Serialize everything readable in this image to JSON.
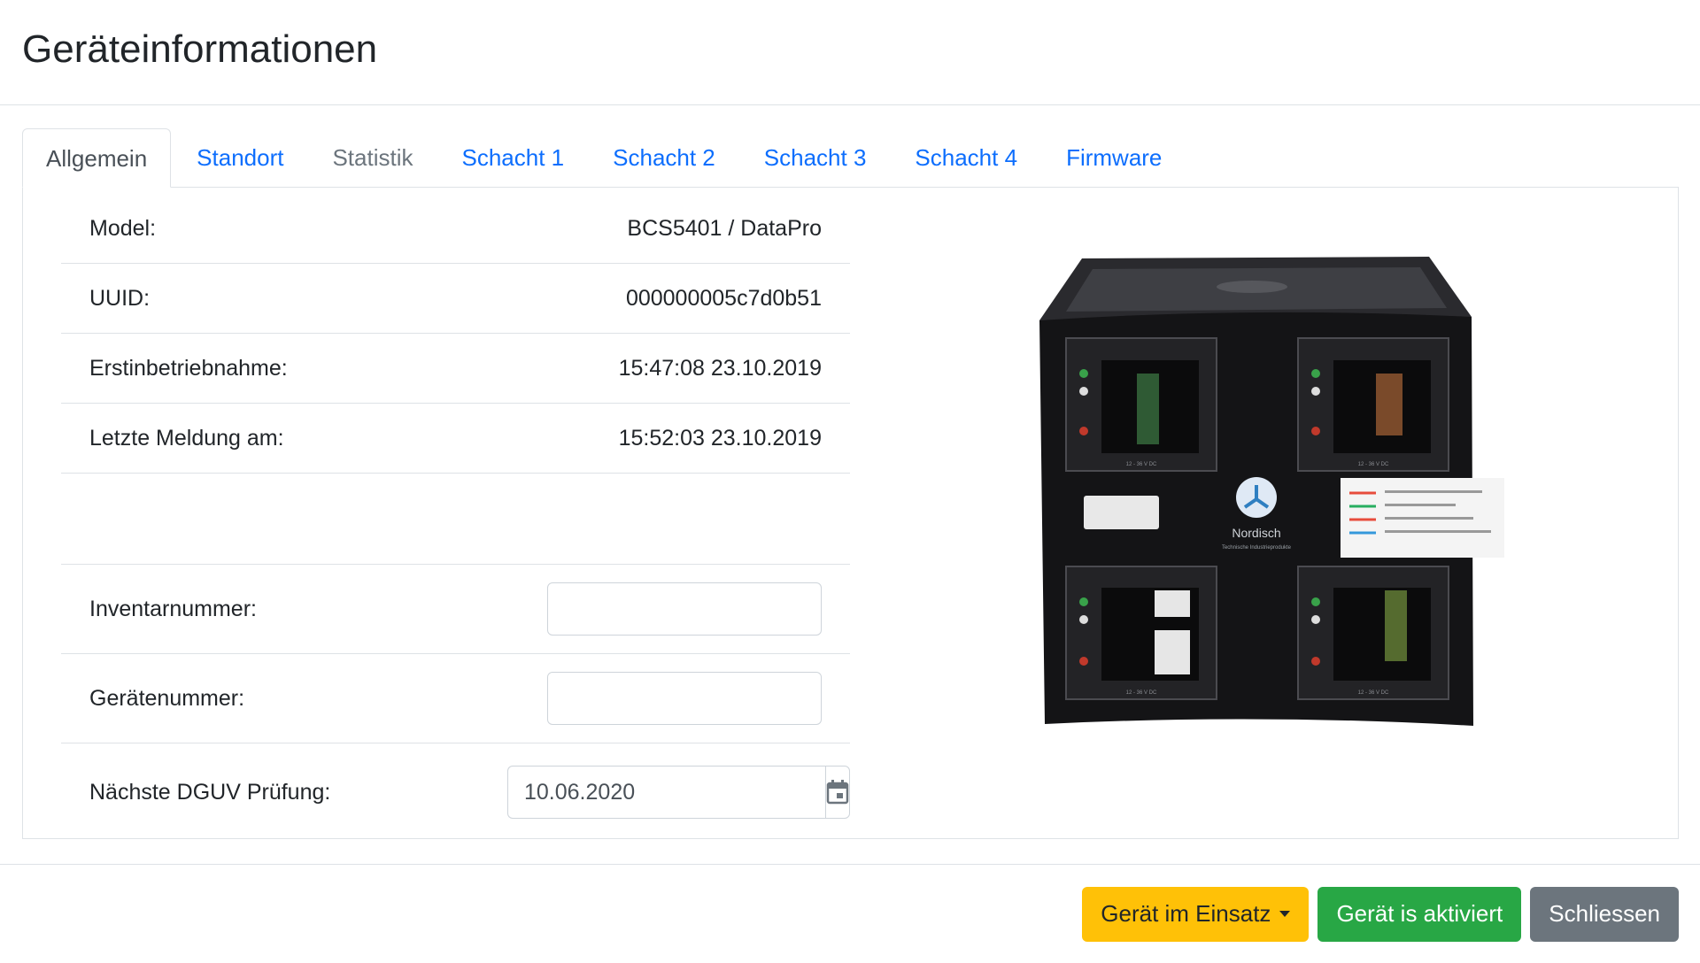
{
  "modal": {
    "title": "Geräteinformationen"
  },
  "tabs": [
    {
      "label": "Allgemein",
      "state": "active"
    },
    {
      "label": "Standort",
      "state": "link"
    },
    {
      "label": "Statistik",
      "state": "disabled"
    },
    {
      "label": "Schacht 1",
      "state": "link"
    },
    {
      "label": "Schacht 2",
      "state": "link"
    },
    {
      "label": "Schacht 3",
      "state": "link"
    },
    {
      "label": "Schacht 4",
      "state": "link"
    },
    {
      "label": "Firmware",
      "state": "link"
    }
  ],
  "info": {
    "model": {
      "label": "Model:",
      "value": "BCS5401 / DataPro"
    },
    "uuid": {
      "label": "UUID:",
      "value": "000000005c7d0b51"
    },
    "first_operation": {
      "label": "Erstinbetriebnahme:",
      "value": "15:47:08 23.10.2019"
    },
    "last_message": {
      "label": "Letzte Meldung am:",
      "value": "15:52:03 23.10.2019"
    }
  },
  "form": {
    "inventory": {
      "label": "Inventarnummer:",
      "value": ""
    },
    "device_number": {
      "label": "Gerätenummer:",
      "value": ""
    },
    "dguv": {
      "label": "Nächste DGUV Prüfung:",
      "value": "10.06.2020"
    }
  },
  "device_image": {
    "brand": "Nordisch",
    "brand_sub": "Technische Industrieprodukte",
    "slot_voltage": "12 - 36 V DC"
  },
  "footer": {
    "status_label": "Gerät im Einsatz",
    "activated_label": "Gerät is aktiviert",
    "close_label": "Schliessen"
  },
  "colors": {
    "accent": "#0d6efd",
    "warning": "#ffc107",
    "success": "#28a745",
    "secondary": "#6c757d"
  }
}
